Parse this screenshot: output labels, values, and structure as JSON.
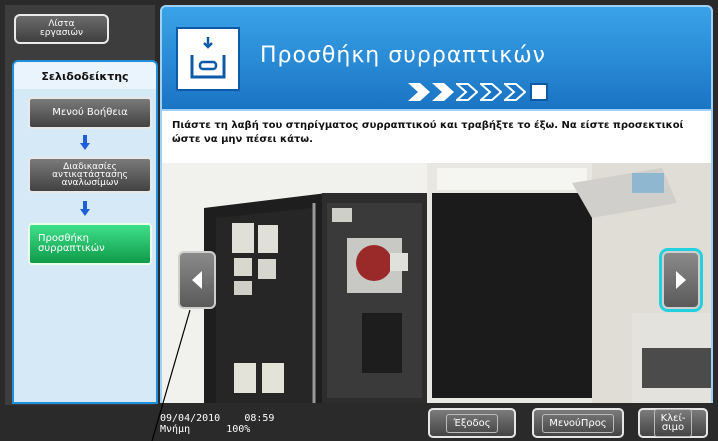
{
  "left_panel": {
    "job_list_label": "Λίστα\nεργασιών",
    "bookmark_tab_label": "Σελιδοδείκτης",
    "items": [
      {
        "label": "Μενού Βοήθεια"
      },
      {
        "label": "Διαδικασίες\nαντικατάστασης\nαναλωσίμων"
      },
      {
        "label": "Προσθήκη\nσυρραπτικών"
      }
    ]
  },
  "header": {
    "title": "Προσθήκη συρραπτικών",
    "steps_total": 6,
    "steps_done": 1
  },
  "instructions": {
    "text": "Πιάστε τη λαβή του στηρίγματος συρραπτικού και τραβήξτε το έξω. Να είστε προσεκτικοί ώστε να μην πέσει κάτω."
  },
  "status": {
    "date": "09/04/2010",
    "time": "08:59",
    "memory_label": "Μνήμη",
    "memory_value": "100%"
  },
  "buttons": {
    "exit": "Έξοδος",
    "prev_menu": "ΜενούΠρος",
    "close": "Κλεί-\nσιμο"
  },
  "colors": {
    "accent_blue": "#1e8fd8",
    "active_green": "#1cb35e",
    "highlight_cyan": "#22d0e0"
  }
}
